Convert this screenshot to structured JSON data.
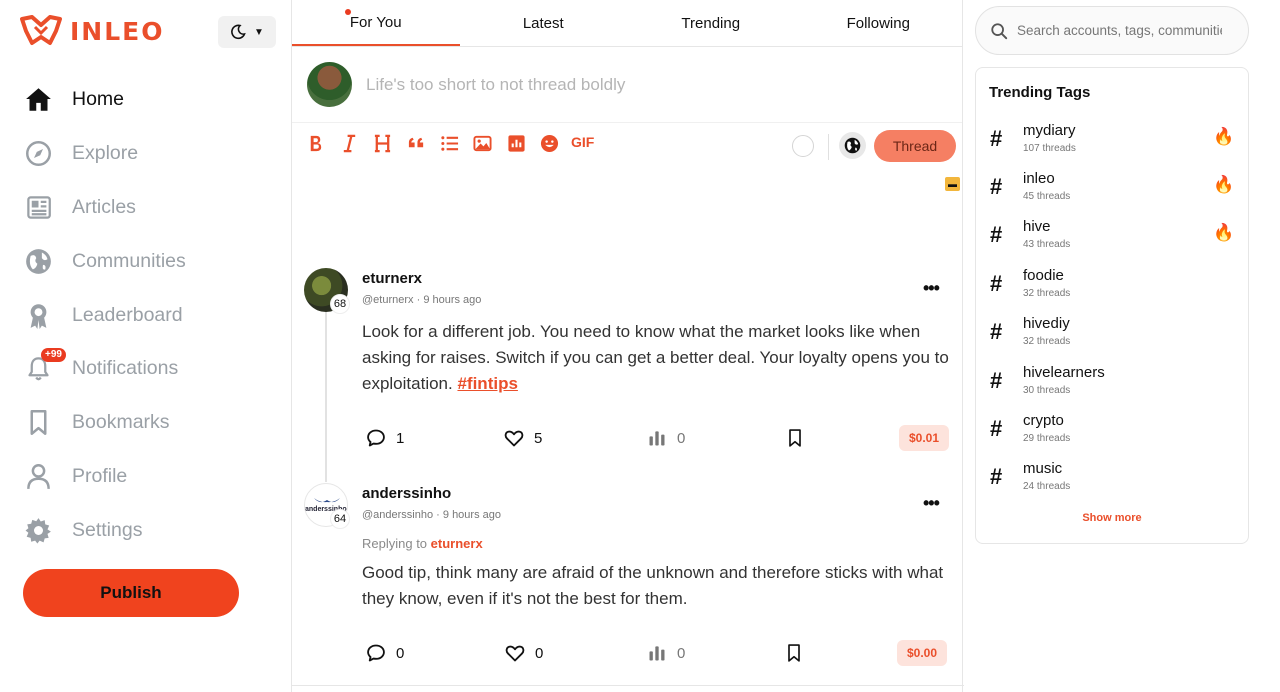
{
  "brand": {
    "name": "INLEO",
    "accent": "#ea4f2b"
  },
  "theme_toggle": {
    "icon": "moon-icon"
  },
  "sidebar": {
    "items": [
      {
        "label": "Home",
        "icon": "home-icon",
        "active": true
      },
      {
        "label": "Explore",
        "icon": "compass-icon"
      },
      {
        "label": "Articles",
        "icon": "newspaper-icon"
      },
      {
        "label": "Communities",
        "icon": "globe-icon"
      },
      {
        "label": "Leaderboard",
        "icon": "award-icon"
      },
      {
        "label": "Notifications",
        "icon": "bell-icon",
        "badge": "+99"
      },
      {
        "label": "Bookmarks",
        "icon": "bookmark-icon"
      },
      {
        "label": "Profile",
        "icon": "user-icon"
      },
      {
        "label": "Settings",
        "icon": "gear-icon"
      }
    ],
    "publish_label": "Publish"
  },
  "tabs": [
    {
      "label": "For You",
      "active": true
    },
    {
      "label": "Latest"
    },
    {
      "label": "Trending"
    },
    {
      "label": "Following"
    }
  ],
  "composer": {
    "placeholder": "Life's too short to not thread boldly",
    "gif_label": "GIF",
    "thread_button": "Thread"
  },
  "posts": [
    {
      "author": "eturnerx",
      "reputation": "68",
      "handle": "@eturnerx",
      "time": "9 hours ago",
      "body": "Look for a different job. You need to know what the market looks like when asking for raises. Switch if you can get a better deal. Your loyalty opens you to exploitation.",
      "hashtag": "#fintips",
      "comments": "1",
      "likes": "5",
      "views": "0",
      "payout": "$0.01"
    },
    {
      "author": "anderssinho",
      "reputation": "64",
      "avatar_text": "anderssinho",
      "handle": "@anderssinho",
      "time": "9 hours ago",
      "replying_label": "Replying to",
      "replying_to": "eturnerx",
      "body": "Good tip, think many are afraid of the unknown and therefore sticks with what they know, even if it's not the best for them.",
      "comments": "0",
      "likes": "0",
      "views": "0",
      "payout": "$0.00"
    }
  ],
  "search": {
    "placeholder": "Search accounts, tags, communities"
  },
  "trending": {
    "title": "Trending Tags",
    "tags": [
      {
        "name": "mydiary",
        "count": "107 threads",
        "hot": true
      },
      {
        "name": "inleo",
        "count": "45 threads",
        "hot": true
      },
      {
        "name": "hive",
        "count": "43 threads",
        "hot": true
      },
      {
        "name": "foodie",
        "count": "32 threads"
      },
      {
        "name": "hivediy",
        "count": "32 threads"
      },
      {
        "name": "hivelearners",
        "count": "30 threads"
      },
      {
        "name": "crypto",
        "count": "29 threads"
      },
      {
        "name": "music",
        "count": "24 threads"
      }
    ],
    "show_more": "Show more"
  }
}
